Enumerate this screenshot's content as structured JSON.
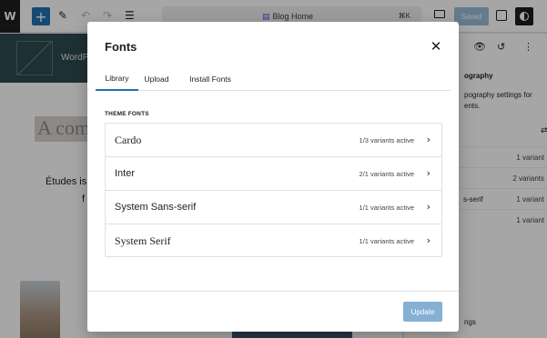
{
  "toolbar": {
    "wp_logo_icon": "wordpress-icon",
    "doc_title": "Blog Home",
    "shortcut": "⌘K",
    "saved_label": "Saved"
  },
  "canvas": {
    "site_title": "WordPress",
    "heading": "A com",
    "text_line1": "Études is",
    "text_line2": "f"
  },
  "sidebar": {
    "heading": "ography",
    "description": "pography settings for ents.",
    "rows": [
      {
        "name": "",
        "count": "1 variant"
      },
      {
        "name": "",
        "count": "2 variants"
      },
      {
        "name": "s-serif",
        "count": "1 variant"
      },
      {
        "name": "",
        "count": "1 variant"
      }
    ],
    "footer": "ngs"
  },
  "modal": {
    "title": "Fonts",
    "tabs": [
      {
        "label": "Library",
        "active": true
      },
      {
        "label": "Upload",
        "active": false
      },
      {
        "label": "Install Fonts",
        "active": false
      }
    ],
    "section_label": "THEME FONTS",
    "fonts": [
      {
        "name": "Cardo",
        "variants": "1/3 variants active"
      },
      {
        "name": "Inter",
        "variants": "2/1 variants active"
      },
      {
        "name": "System Sans-serif",
        "variants": "1/1 variants active"
      },
      {
        "name": "System Serif",
        "variants": "1/1 variants active"
      }
    ],
    "update_label": "Update"
  },
  "colors": {
    "accent": "#2271b1",
    "header_bg": "#2d4a4f",
    "purple": "#7c3aed"
  }
}
